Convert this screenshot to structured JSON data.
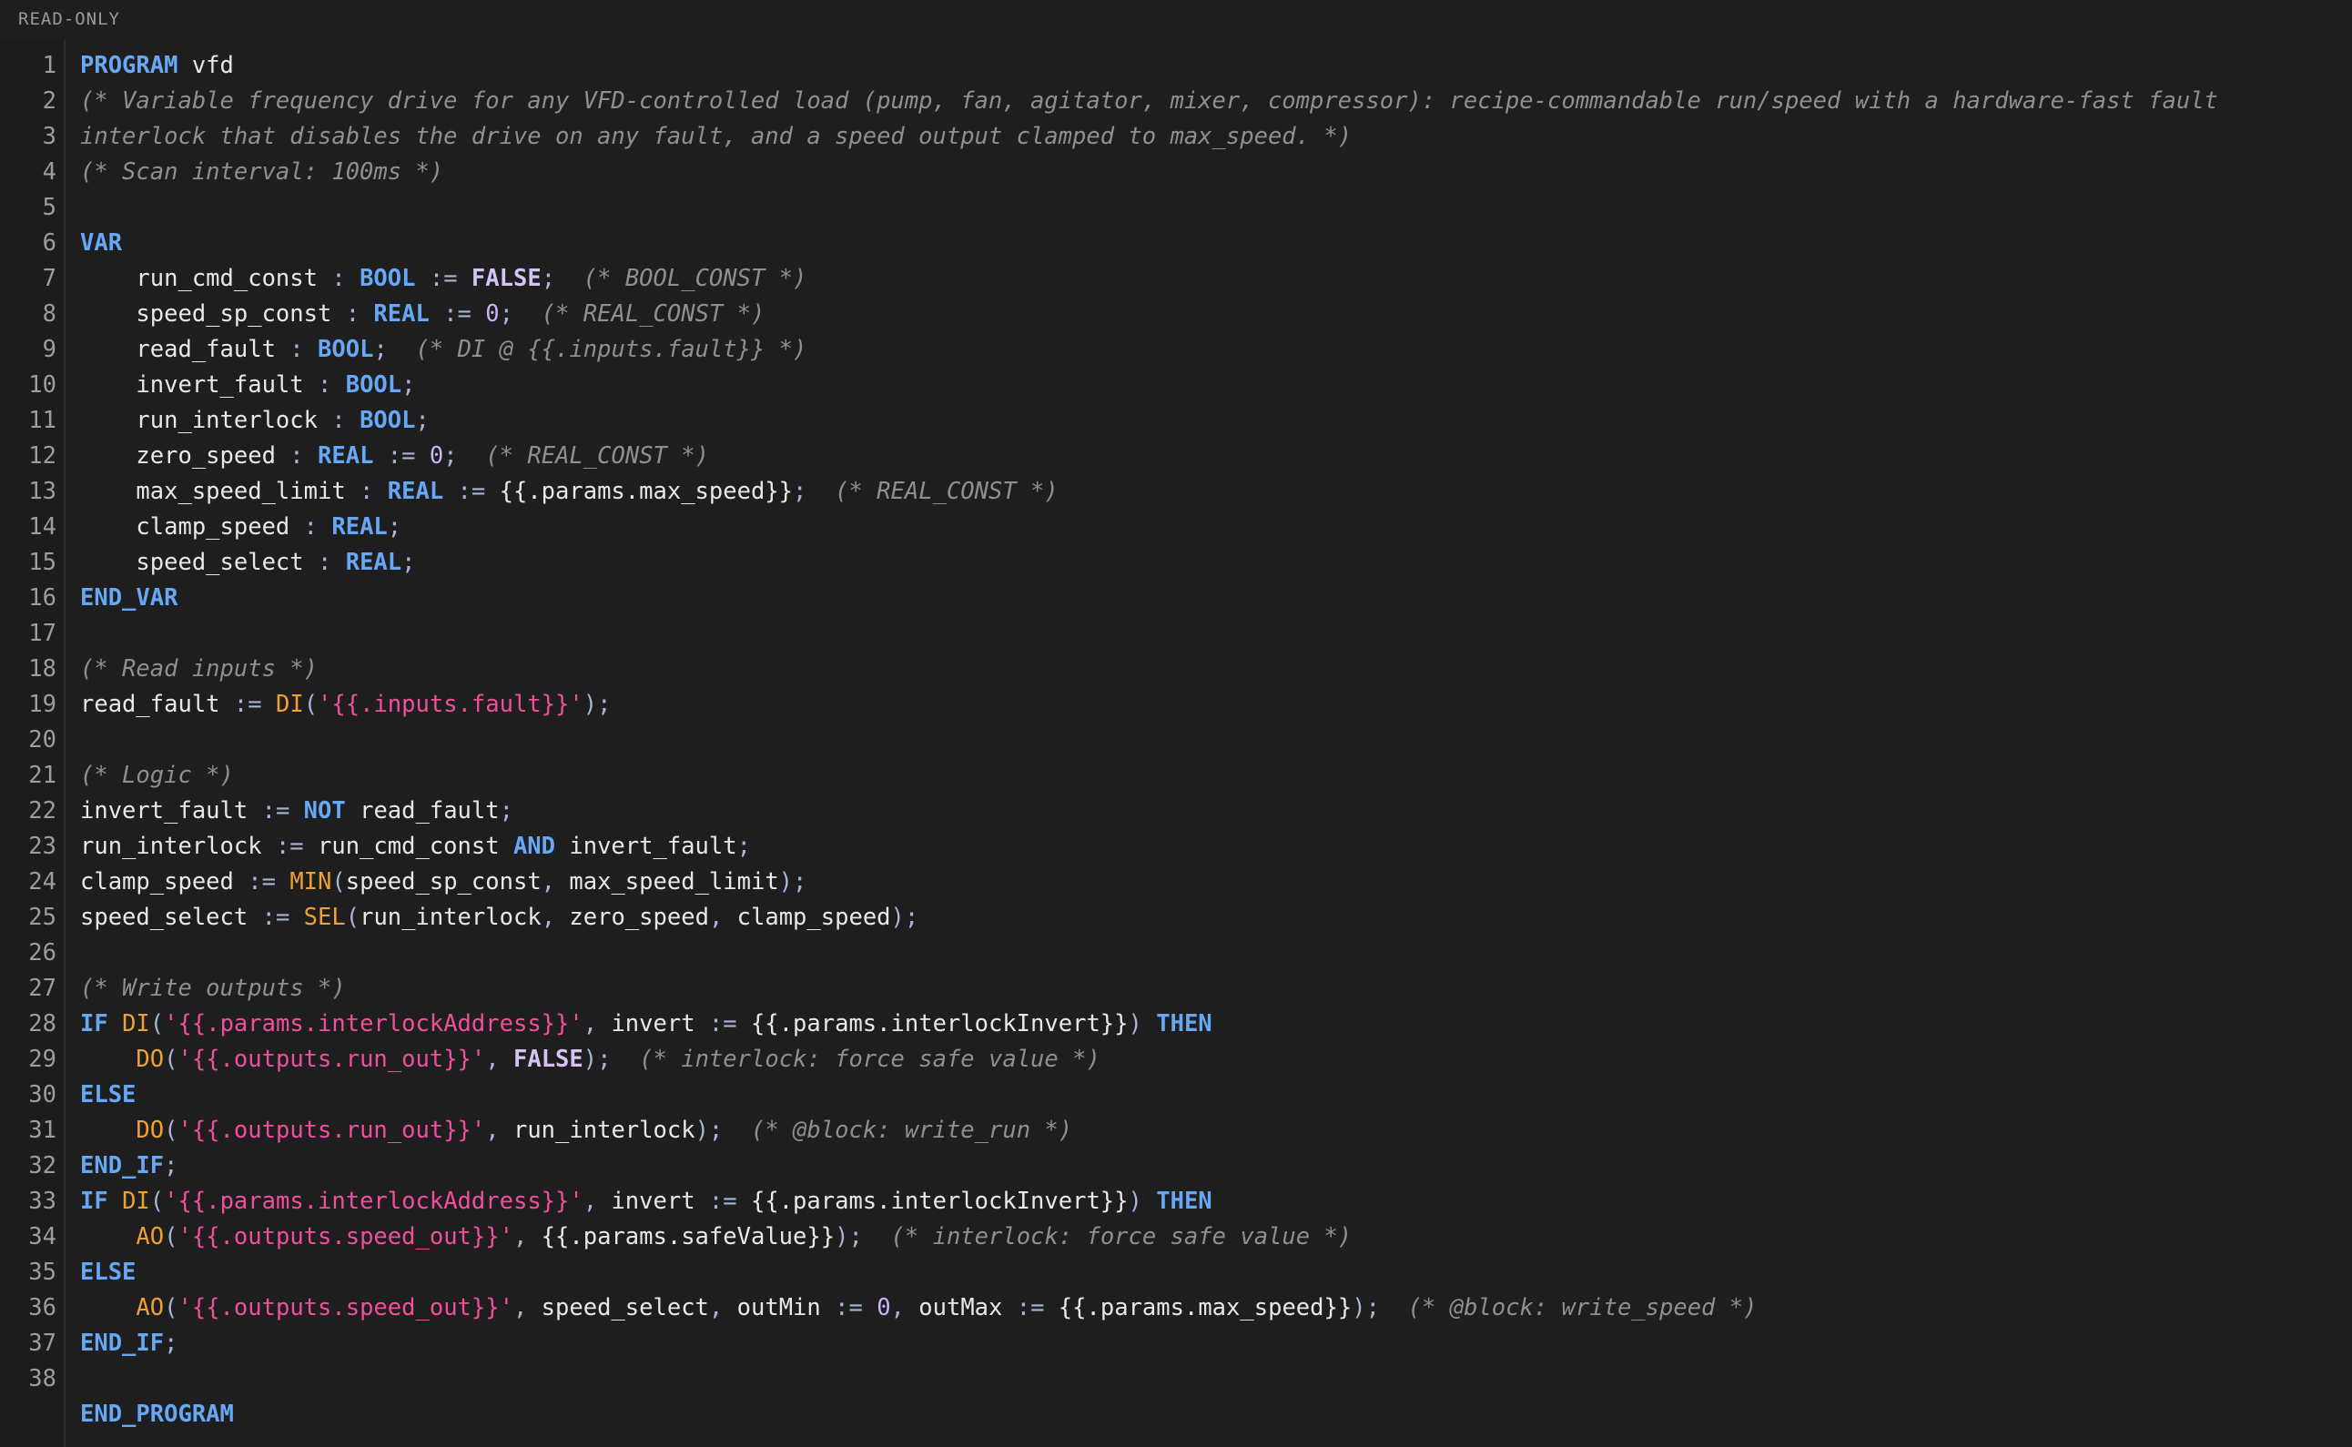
{
  "toolbar": {
    "readonly_label": "READ-ONLY"
  },
  "theme": {
    "background": "#1e1e1e",
    "keyword": "#66a8f5",
    "boolean": "#d6c3f5",
    "comment": "#8f8f8f",
    "function": "#f0a030",
    "string": "#ef4f9c",
    "text": "#e8e8e8",
    "line_number": "#9d9d9d"
  },
  "lines": [
    {
      "n": "1",
      "tokens": [
        [
          "kw",
          "PROGRAM"
        ],
        [
          "t",
          " vfd"
        ]
      ]
    },
    {
      "n": "2",
      "tokens": [
        [
          "cm",
          "(* Variable frequency drive for any VFD-controlled load (pump, fan, agitator, mixer, compressor): recipe-commandable run/speed with a hardware-fast fault"
        ]
      ]
    },
    {
      "n": "3",
      "tokens": [
        [
          "cm",
          "interlock that disables the drive on any fault, and a speed output clamped to max_speed. *)"
        ]
      ]
    },
    {
      "n": "4",
      "tokens": [
        [
          "cm",
          "(* Scan interval: 100ms *)"
        ]
      ]
    },
    {
      "n": "5",
      "tokens": []
    },
    {
      "n": "6",
      "tokens": [
        [
          "kw",
          "VAR"
        ]
      ]
    },
    {
      "n": "7",
      "tokens": [
        [
          "t",
          "    run_cmd_const "
        ],
        [
          "op",
          ":"
        ],
        [
          "t",
          " "
        ],
        [
          "kw",
          "BOOL"
        ],
        [
          "t",
          " "
        ],
        [
          "op",
          ":="
        ],
        [
          "t",
          " "
        ],
        [
          "bool",
          "FALSE"
        ],
        [
          "op",
          ";"
        ],
        [
          "t",
          "  "
        ],
        [
          "cm",
          "(* BOOL_CONST *)"
        ]
      ]
    },
    {
      "n": "8",
      "tokens": [
        [
          "t",
          "    speed_sp_const "
        ],
        [
          "op",
          ":"
        ],
        [
          "t",
          " "
        ],
        [
          "kw",
          "REAL"
        ],
        [
          "t",
          " "
        ],
        [
          "op",
          ":="
        ],
        [
          "t",
          " "
        ],
        [
          "num",
          "0"
        ],
        [
          "op",
          ";"
        ],
        [
          "t",
          "  "
        ],
        [
          "cm",
          "(* REAL_CONST *)"
        ]
      ]
    },
    {
      "n": "9",
      "tokens": [
        [
          "t",
          "    read_fault "
        ],
        [
          "op",
          ":"
        ],
        [
          "t",
          " "
        ],
        [
          "kw",
          "BOOL"
        ],
        [
          "op",
          ";"
        ],
        [
          "t",
          "  "
        ],
        [
          "cm",
          "(* DI @ {{.inputs.fault}} *)"
        ]
      ]
    },
    {
      "n": "10",
      "tokens": [
        [
          "t",
          "    invert_fault "
        ],
        [
          "op",
          ":"
        ],
        [
          "t",
          " "
        ],
        [
          "kw",
          "BOOL"
        ],
        [
          "op",
          ";"
        ]
      ]
    },
    {
      "n": "11",
      "tokens": [
        [
          "t",
          "    run_interlock "
        ],
        [
          "op",
          ":"
        ],
        [
          "t",
          " "
        ],
        [
          "kw",
          "BOOL"
        ],
        [
          "op",
          ";"
        ]
      ]
    },
    {
      "n": "12",
      "tokens": [
        [
          "t",
          "    zero_speed "
        ],
        [
          "op",
          ":"
        ],
        [
          "t",
          " "
        ],
        [
          "kw",
          "REAL"
        ],
        [
          "t",
          " "
        ],
        [
          "op",
          ":="
        ],
        [
          "t",
          " "
        ],
        [
          "num",
          "0"
        ],
        [
          "op",
          ";"
        ],
        [
          "t",
          "  "
        ],
        [
          "cm",
          "(* REAL_CONST *)"
        ]
      ]
    },
    {
      "n": "13",
      "tokens": [
        [
          "t",
          "    max_speed_limit "
        ],
        [
          "op",
          ":"
        ],
        [
          "t",
          " "
        ],
        [
          "kw",
          "REAL"
        ],
        [
          "t",
          " "
        ],
        [
          "op",
          ":="
        ],
        [
          "t",
          " {{.params.max_speed}}"
        ],
        [
          "op",
          ";"
        ],
        [
          "t",
          "  "
        ],
        [
          "cm",
          "(* REAL_CONST *)"
        ]
      ]
    },
    {
      "n": "14",
      "tokens": [
        [
          "t",
          "    clamp_speed "
        ],
        [
          "op",
          ":"
        ],
        [
          "t",
          " "
        ],
        [
          "kw",
          "REAL"
        ],
        [
          "op",
          ";"
        ]
      ]
    },
    {
      "n": "15",
      "tokens": [
        [
          "t",
          "    speed_select "
        ],
        [
          "op",
          ":"
        ],
        [
          "t",
          " "
        ],
        [
          "kw",
          "REAL"
        ],
        [
          "op",
          ";"
        ]
      ]
    },
    {
      "n": "16",
      "tokens": [
        [
          "kw",
          "END_VAR"
        ]
      ]
    },
    {
      "n": "17",
      "tokens": []
    },
    {
      "n": "18",
      "tokens": [
        [
          "cm",
          "(* Read inputs *)"
        ]
      ]
    },
    {
      "n": "19",
      "tokens": [
        [
          "t",
          "read_fault "
        ],
        [
          "op",
          ":="
        ],
        [
          "t",
          " "
        ],
        [
          "fn",
          "DI"
        ],
        [
          "op",
          "("
        ],
        [
          "str",
          "'{{.inputs.fault}}'"
        ],
        [
          "op",
          ");"
        ]
      ]
    },
    {
      "n": "20",
      "tokens": []
    },
    {
      "n": "21",
      "tokens": [
        [
          "cm",
          "(* Logic *)"
        ]
      ]
    },
    {
      "n": "22",
      "tokens": [
        [
          "t",
          "invert_fault "
        ],
        [
          "op",
          ":="
        ],
        [
          "t",
          " "
        ],
        [
          "kw",
          "NOT"
        ],
        [
          "t",
          " read_fault"
        ],
        [
          "op",
          ";"
        ]
      ]
    },
    {
      "n": "23",
      "tokens": [
        [
          "t",
          "run_interlock "
        ],
        [
          "op",
          ":="
        ],
        [
          "t",
          " run_cmd_const "
        ],
        [
          "kw",
          "AND"
        ],
        [
          "t",
          " invert_fault"
        ],
        [
          "op",
          ";"
        ]
      ]
    },
    {
      "n": "24",
      "tokens": [
        [
          "t",
          "clamp_speed "
        ],
        [
          "op",
          ":="
        ],
        [
          "t",
          " "
        ],
        [
          "fn",
          "MIN"
        ],
        [
          "op",
          "("
        ],
        [
          "t",
          "speed_sp_const"
        ],
        [
          "op",
          ","
        ],
        [
          "t",
          " max_speed_limit"
        ],
        [
          "op",
          ");"
        ]
      ]
    },
    {
      "n": "25",
      "tokens": [
        [
          "t",
          "speed_select "
        ],
        [
          "op",
          ":="
        ],
        [
          "t",
          " "
        ],
        [
          "fn",
          "SEL"
        ],
        [
          "op",
          "("
        ],
        [
          "t",
          "run_interlock"
        ],
        [
          "op",
          ","
        ],
        [
          "t",
          " zero_speed"
        ],
        [
          "op",
          ","
        ],
        [
          "t",
          " clamp_speed"
        ],
        [
          "op",
          ");"
        ]
      ]
    },
    {
      "n": "26",
      "tokens": []
    },
    {
      "n": "27",
      "tokens": [
        [
          "cm",
          "(* Write outputs *)"
        ]
      ]
    },
    {
      "n": "28",
      "tokens": [
        [
          "kw",
          "IF"
        ],
        [
          "t",
          " "
        ],
        [
          "fn",
          "DI"
        ],
        [
          "op",
          "("
        ],
        [
          "str",
          "'{{.params.interlockAddress}}'"
        ],
        [
          "op",
          ","
        ],
        [
          "t",
          " invert "
        ],
        [
          "op",
          ":="
        ],
        [
          "t",
          " {{.params.interlockInvert}}"
        ],
        [
          "op",
          ")"
        ],
        [
          "t",
          " "
        ],
        [
          "kw",
          "THEN"
        ]
      ]
    },
    {
      "n": "29",
      "tokens": [
        [
          "t",
          "    "
        ],
        [
          "fn",
          "DO"
        ],
        [
          "op",
          "("
        ],
        [
          "str",
          "'{{.outputs.run_out}}'"
        ],
        [
          "op",
          ","
        ],
        [
          "t",
          " "
        ],
        [
          "bool",
          "FALSE"
        ],
        [
          "op",
          ");"
        ],
        [
          "t",
          "  "
        ],
        [
          "cm",
          "(* interlock: force safe value *)"
        ]
      ]
    },
    {
      "n": "30",
      "tokens": [
        [
          "kw",
          "ELSE"
        ]
      ]
    },
    {
      "n": "31",
      "tokens": [
        [
          "t",
          "    "
        ],
        [
          "fn",
          "DO"
        ],
        [
          "op",
          "("
        ],
        [
          "str",
          "'{{.outputs.run_out}}'"
        ],
        [
          "op",
          ","
        ],
        [
          "t",
          " run_interlock"
        ],
        [
          "op",
          ");"
        ],
        [
          "t",
          "  "
        ],
        [
          "cm",
          "(* @block: write_run *)"
        ]
      ]
    },
    {
      "n": "32",
      "tokens": [
        [
          "kw",
          "END_IF"
        ],
        [
          "op",
          ";"
        ]
      ]
    },
    {
      "n": "33",
      "tokens": [
        [
          "kw",
          "IF"
        ],
        [
          "t",
          " "
        ],
        [
          "fn",
          "DI"
        ],
        [
          "op",
          "("
        ],
        [
          "str",
          "'{{.params.interlockAddress}}'"
        ],
        [
          "op",
          ","
        ],
        [
          "t",
          " invert "
        ],
        [
          "op",
          ":="
        ],
        [
          "t",
          " {{.params.interlockInvert}}"
        ],
        [
          "op",
          ")"
        ],
        [
          "t",
          " "
        ],
        [
          "kw",
          "THEN"
        ]
      ]
    },
    {
      "n": "34",
      "tokens": [
        [
          "t",
          "    "
        ],
        [
          "fn",
          "AO"
        ],
        [
          "op",
          "("
        ],
        [
          "str",
          "'{{.outputs.speed_out}}'"
        ],
        [
          "op",
          ","
        ],
        [
          "t",
          " {{.params.safeValue}}"
        ],
        [
          "op",
          ");"
        ],
        [
          "t",
          "  "
        ],
        [
          "cm",
          "(* interlock: force safe value *)"
        ]
      ]
    },
    {
      "n": "35",
      "tokens": [
        [
          "kw",
          "ELSE"
        ]
      ]
    },
    {
      "n": "36",
      "tokens": [
        [
          "t",
          "    "
        ],
        [
          "fn",
          "AO"
        ],
        [
          "op",
          "("
        ],
        [
          "str",
          "'{{.outputs.speed_out}}'"
        ],
        [
          "op",
          ","
        ],
        [
          "t",
          " speed_select"
        ],
        [
          "op",
          ","
        ],
        [
          "t",
          " outMin "
        ],
        [
          "op",
          ":="
        ],
        [
          "t",
          " "
        ],
        [
          "num",
          "0"
        ],
        [
          "op",
          ","
        ],
        [
          "t",
          " outMax "
        ],
        [
          "op",
          ":="
        ],
        [
          "t",
          " {{.params.max_speed}}"
        ],
        [
          "op",
          ");"
        ],
        [
          "t",
          "  "
        ],
        [
          "cm",
          "(* @block: write_speed *)"
        ]
      ]
    },
    {
      "n": "37",
      "tokens": [
        [
          "kw",
          "END_IF"
        ],
        [
          "op",
          ";"
        ]
      ]
    },
    {
      "n": "38",
      "tokens": []
    },
    {
      "n": "",
      "tokens": [
        [
          "kw",
          "END_PROGRAM"
        ]
      ]
    }
  ]
}
